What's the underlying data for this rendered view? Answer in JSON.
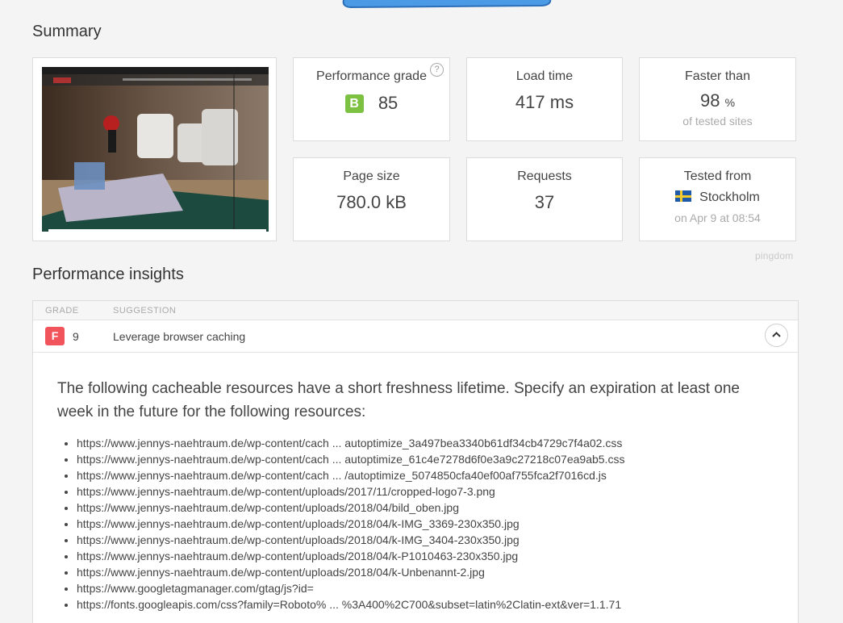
{
  "summary": {
    "title": "Summary",
    "performance_grade": {
      "label": "Performance grade",
      "grade": "B",
      "score": "85",
      "help": "?"
    },
    "load_time": {
      "label": "Load time",
      "value": "417 ms"
    },
    "faster_than": {
      "label": "Faster than",
      "value": "98",
      "unit": "%",
      "sub": "of tested sites"
    },
    "page_size": {
      "label": "Page size",
      "value": "780.0 kB"
    },
    "requests": {
      "label": "Requests",
      "value": "37"
    },
    "tested_from": {
      "label": "Tested from",
      "location": "Stockholm",
      "date": "on Apr 9 at 08:54"
    },
    "brand": "pingdom"
  },
  "insights": {
    "title": "Performance insights",
    "headers": {
      "grade": "GRADE",
      "suggestion": "SUGGESTION"
    },
    "rows": [
      {
        "grade": "F",
        "score": "9",
        "suggestion": "Leverage browser caching"
      }
    ],
    "detail_text": "The following cacheable resources have a short freshness lifetime. Specify an expiration at least one week in the future for the following resources:",
    "resources": [
      "https://www.jennys-naehtraum.de/wp-content/cach ... autoptimize_3a497bea3340b61df34cb4729c7f4a02.css",
      "https://www.jennys-naehtraum.de/wp-content/cach ... autoptimize_61c4e7278d6f0e3a9c27218c07ea9ab5.css",
      "https://www.jennys-naehtraum.de/wp-content/cach ... /autoptimize_5074850cfa40ef00af755fca2f7016cd.js",
      "https://www.jennys-naehtraum.de/wp-content/uploads/2017/11/cropped-logo7-3.png",
      "https://www.jennys-naehtraum.de/wp-content/uploads/2018/04/bild_oben.jpg",
      "https://www.jennys-naehtraum.de/wp-content/uploads/2018/04/k-IMG_3369-230x350.jpg",
      "https://www.jennys-naehtraum.de/wp-content/uploads/2018/04/k-IMG_3404-230x350.jpg",
      "https://www.jennys-naehtraum.de/wp-content/uploads/2018/04/k-P1010463-230x350.jpg",
      "https://www.jennys-naehtraum.de/wp-content/uploads/2018/04/k-Unbenannt-2.jpg",
      "https://www.googletagmanager.com/gtag/js?id=",
      "https://fonts.googleapis.com/css?family=Roboto% ... %3A400%2C700&subset=latin%2Clatin-ext&ver=1.1.71"
    ]
  },
  "colors": {
    "grade_b": "#7cc142",
    "grade_f": "#f2545b",
    "accent_blue": "#3d8ee0"
  }
}
